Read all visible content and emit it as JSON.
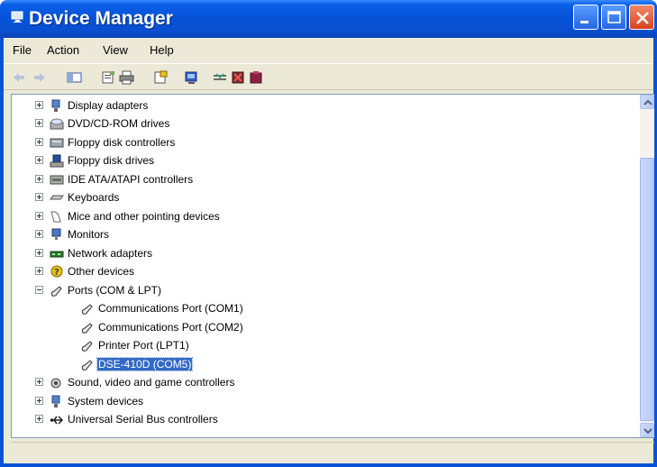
{
  "window": {
    "title": "Device Manager"
  },
  "menu": {
    "items": [
      "File",
      "Action",
      "View",
      "Help"
    ]
  },
  "tree": {
    "items": [
      {
        "label": "Display adapters",
        "icon": "display-adapter-icon"
      },
      {
        "label": "DVD/CD-ROM drives",
        "icon": "cdrom-drive-icon"
      },
      {
        "label": "Floppy disk controllers",
        "icon": "floppy-controller-icon"
      },
      {
        "label": "Floppy disk drives",
        "icon": "floppy-drive-icon"
      },
      {
        "label": "IDE ATA/ATAPI controllers",
        "icon": "ide-controller-icon"
      },
      {
        "label": "Keyboards",
        "icon": "keyboard-icon"
      },
      {
        "label": "Mice and other pointing devices",
        "icon": "mouse-icon"
      },
      {
        "label": "Monitors",
        "icon": "monitor-icon"
      },
      {
        "label": "Network adapters",
        "icon": "network-adapter-icon"
      },
      {
        "label": "Other devices",
        "icon": "other-devices-icon"
      },
      {
        "label": "Ports (COM & LPT)",
        "icon": "port-icon",
        "expanded": true,
        "children": [
          {
            "label": "Communications Port (COM1)",
            "icon": "port-icon"
          },
          {
            "label": "Communications Port (COM2)",
            "icon": "port-icon"
          },
          {
            "label": "Printer Port (LPT1)",
            "icon": "port-icon"
          },
          {
            "label": "DSE-410D (COM5)",
            "icon": "port-icon",
            "selected": true
          }
        ]
      },
      {
        "label": "Sound, video and game controllers",
        "icon": "sound-icon"
      },
      {
        "label": "System devices",
        "icon": "system-device-icon"
      },
      {
        "label": "Universal Serial Bus controllers",
        "icon": "usb-icon"
      }
    ]
  },
  "colors": {
    "titlebar": "#0a52d6",
    "selection": "#316ac5",
    "chrome": "#ece9d8"
  }
}
